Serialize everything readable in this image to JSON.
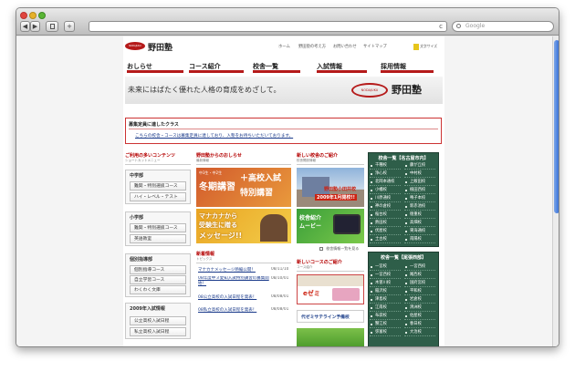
{
  "browser": {
    "search_placeholder": "Google",
    "back_glyph": "◀",
    "forward_glyph": "▶",
    "reload_glyph": "c",
    "search_icon": "search-icon"
  },
  "site": {
    "logo_text": "野田塾",
    "logo_badge": "NODAJUKU",
    "hero_logo_text": "野田塾",
    "hero_badge": "NODAJUKU",
    "tagline": "未来にはばたく優れた人格の育成をめざして。",
    "utility_links": [
      "ホーム",
      "野田塾の考え方",
      "お問い合わせ",
      "サイトマップ"
    ],
    "font_size_label": "文字サイズ",
    "nav": [
      "おしらせ",
      "コース紹介",
      "校舎一覧",
      "入試情報",
      "採用情報"
    ]
  },
  "notice": {
    "title": "募集定員に達したクラス",
    "text": "こちらの校舎・コースは募集定員に達しており、入塾をお待ちいただいております。"
  },
  "sidebar": {
    "title": "ご利用の多いコンテンツ",
    "subtitle": "ショートカットメニュー",
    "groups": [
      {
        "title": "中学部",
        "items": [
          "難関・特別選抜コース",
          "ハイ・レベル・テスト"
        ]
      },
      {
        "title": "小学部",
        "items": [
          "難関・特別選抜コース",
          "英語教室"
        ]
      },
      {
        "title": "個別指導部",
        "items": [
          "個別指導コース",
          "自立学習コース",
          "わくわく文庫"
        ]
      },
      {
        "title": "2009年入試情報",
        "items": [
          "公立高校入試日程",
          "私立高校入試日程"
        ]
      }
    ]
  },
  "news": {
    "title": "野田塾からのおしらせ",
    "subtitle": "最新情報",
    "banner1_lines": [
      "中3生・中2生",
      "冬期講習",
      "＋高校入試",
      "特別講習"
    ],
    "banner2_lines": [
      "マナカナから",
      "受験生に贈る",
      "メッセージ!!"
    ]
  },
  "newclass": {
    "title": "新しい校舎のご紹介",
    "subtitle": "校舎開設情報",
    "photo1_lines": [
      "野田塾小田井校",
      "2009年1月開校!!"
    ],
    "photo2_lines": [
      "校舎紹介",
      "ムービー"
    ],
    "more_link": "校舎情報一覧を見る"
  },
  "newcourse": {
    "title": "新しいコースのご紹介",
    "subtitle": "コース紹介",
    "ad1": "eゼミ",
    "ad2": "代ゼミサテライン予備校"
  },
  "topics": {
    "title": "新着情報",
    "subtitle": "トピックス",
    "items": [
      {
        "text": "マナカナメッセージ熱編公開！",
        "date": "08/11/10"
      },
      {
        "text": "08年度中３愛知入試特別講習の募集開始！",
        "date": "08/10/01"
      },
      {
        "text": "08公立高校の入試日程を発表！",
        "date": "08/08/01"
      },
      {
        "text": "08私立高校の入試日程を発表！",
        "date": "08/08/01"
      }
    ]
  },
  "campus1": {
    "title": "校舎一覧【名古屋市内】",
    "cells": [
      "千種校",
      "藤が丘校",
      "浄心校",
      "中村校",
      "北岡本通校",
      "上飯田校",
      "小幡校",
      "植田西校",
      "川原通校",
      "鳴子本校",
      "神の倉校",
      "新赤池校",
      "桜台校",
      "徳重校",
      "熱田校",
      "高畑校",
      "伏屋校",
      "東海通校",
      "土古校",
      "南陽校"
    ]
  },
  "campus2": {
    "title": "校舎一覧【尾張西部】",
    "cells": [
      "一宮校",
      "一宮西校",
      "一宮西校",
      "尾西校",
      "木曽川校",
      "国府宮校",
      "稲沢校",
      "平和校",
      "津島校",
      "岩倉校",
      "江南校",
      "清洲校",
      "布袋校",
      "佐屋校",
      "蟹江校",
      "春日校",
      "弥富校",
      "大治校"
    ]
  },
  "colors": {
    "accent": "#b51a1a",
    "green_panel": "#2e5e49",
    "link": "#1a3a8a"
  }
}
